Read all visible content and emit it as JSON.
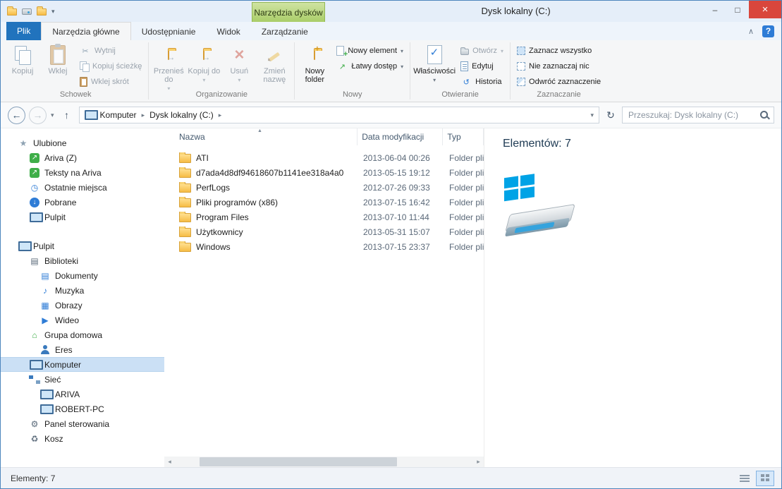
{
  "window": {
    "title": "Dysk lokalny (C:)",
    "contextual_header": "Narzędzia dysków",
    "controls": {
      "minimize": "–",
      "maximize": "□",
      "close": "×"
    }
  },
  "tabs": {
    "file": "Plik",
    "home": "Narzędzia główne",
    "share": "Udostępnianie",
    "view": "Widok",
    "manage": "Zarządzanie",
    "help": "?"
  },
  "ribbon": {
    "clipboard": {
      "group_label": "Schowek",
      "copy": "Kopiuj",
      "paste": "Wklej",
      "cut": "Wytnij",
      "copy_path": "Kopiuj ścieżkę",
      "paste_shortcut": "Wklej skrót"
    },
    "organize": {
      "group_label": "Organizowanie",
      "move_to": "Przenieś do",
      "copy_to": "Kopiuj do",
      "delete": "Usuń",
      "rename": "Zmień nazwę"
    },
    "new": {
      "group_label": "Nowy",
      "new_folder": "Nowy folder",
      "new_item": "Nowy element",
      "easy_access": "Łatwy dostęp"
    },
    "open": {
      "group_label": "Otwieranie",
      "properties": "Właściwości",
      "open": "Otwórz",
      "edit": "Edytuj",
      "history": "Historia"
    },
    "select": {
      "group_label": "Zaznaczanie",
      "select_all": "Zaznacz wszystko",
      "select_none": "Nie zaznaczaj nic",
      "invert_selection": "Odwróć zaznaczenie"
    }
  },
  "address": {
    "crumb_root": "Komputer",
    "crumb_current": "Dysk lokalny (C:)",
    "search_placeholder": "Przeszukaj: Dysk lokalny (C:)"
  },
  "nav": {
    "favorites_label": "Ulubione",
    "favorites": [
      {
        "label": "Ariva (Z)"
      },
      {
        "label": "Teksty na Ariva"
      },
      {
        "label": "Ostatnie miejsca"
      },
      {
        "label": "Pobrane"
      },
      {
        "label": "Pulpit"
      }
    ],
    "desktop_label": "Pulpit",
    "desktop": [
      {
        "label": "Biblioteki"
      },
      {
        "label": "Dokumenty"
      },
      {
        "label": "Muzyka"
      },
      {
        "label": "Obrazy"
      },
      {
        "label": "Wideo"
      },
      {
        "label": "Grupa domowa"
      },
      {
        "label": "Eres"
      },
      {
        "label": "Komputer",
        "selected": true
      },
      {
        "label": "Sieć"
      },
      {
        "label": "ARIVA"
      },
      {
        "label": "ROBERT-PC"
      },
      {
        "label": "Panel sterowania"
      },
      {
        "label": "Kosz"
      }
    ]
  },
  "list": {
    "columns": {
      "name": "Nazwa",
      "modified": "Data modyfikacji",
      "type": "Typ"
    },
    "rows": [
      {
        "name": "ATI",
        "modified": "2013-06-04 00:26",
        "type": "Folder plik"
      },
      {
        "name": "d7ada4d8df94618607b1141ee318a4a0",
        "modified": "2013-05-15 19:12",
        "type": "Folder plik"
      },
      {
        "name": "PerfLogs",
        "modified": "2012-07-26 09:33",
        "type": "Folder plik"
      },
      {
        "name": "Pliki programów (x86)",
        "modified": "2013-07-15 16:42",
        "type": "Folder plik"
      },
      {
        "name": "Program Files",
        "modified": "2013-07-10 11:44",
        "type": "Folder plik"
      },
      {
        "name": "Użytkownicy",
        "modified": "2013-05-31 15:07",
        "type": "Folder plik"
      },
      {
        "name": "Windows",
        "modified": "2013-07-15 23:37",
        "type": "Folder plik"
      }
    ]
  },
  "details": {
    "count": "Elementów: 7"
  },
  "statusbar": {
    "count": "Elementy: 7"
  },
  "glyphs": {
    "chevron_down": "▾",
    "chevron_up": "∧",
    "back": "←",
    "forward": "→",
    "up": "↑",
    "refresh": "↻",
    "crumb_sep": "▸",
    "sort_asc": "▲",
    "scroll_left": "◂",
    "scroll_right": "▸",
    "cut": "✂",
    "history": "↺",
    "star": "★",
    "clock": "◷",
    "download": "↓",
    "library": "▤",
    "documents": "▤",
    "music": "♪",
    "pictures": "▦",
    "video": "▶",
    "home": "⌂",
    "gear": "⚙",
    "recycle": "♻",
    "arrow_ne": "↗",
    "delete": "×"
  },
  "colors": {
    "accent_blue": "#2173bd",
    "contextual_green": "#a9cd68",
    "close_red": "#d9463c",
    "selection_blue": "#cbe0f5",
    "windows_logo_blue": "#00a3e6",
    "folder_yellow": "#f6bc45"
  }
}
